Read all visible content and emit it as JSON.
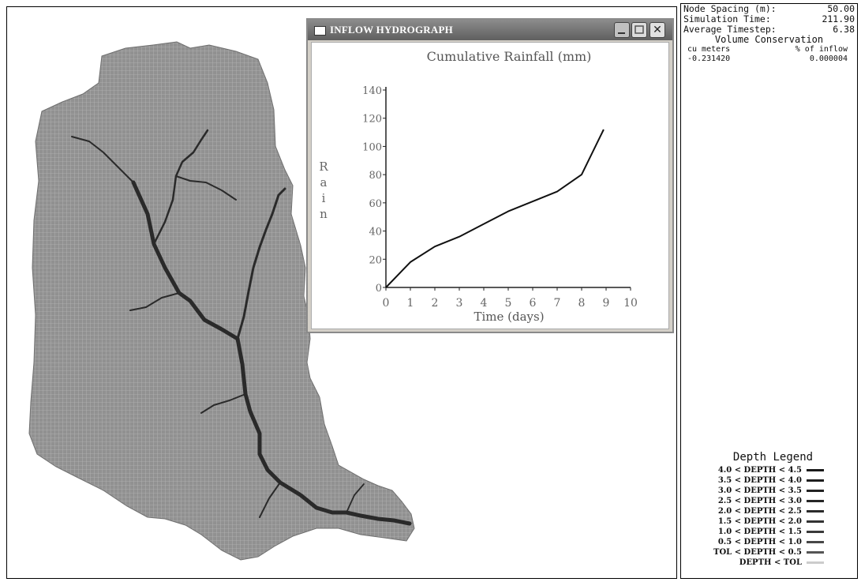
{
  "stats": {
    "node_spacing_label": "Node Spacing (m):",
    "node_spacing_value": "50.00",
    "simulation_time_label": "Simulation Time:",
    "simulation_time_value": "211.90",
    "average_timestep_label": "Average Timestep:",
    "average_timestep_value": "6.38"
  },
  "volume_conservation": {
    "title": "Volume Conservation",
    "col1_header": "cu meters",
    "col2_header": "% of inflow",
    "cu_meters": "-0.231420",
    "percent_inflow": "0.000004"
  },
  "legend": {
    "title": "Depth Legend",
    "items": [
      {
        "label": "4.0 < DEPTH < 4.5",
        "color": "#1a1a1a"
      },
      {
        "label": "3.5 < DEPTH < 4.0",
        "color": "#1e1e1e"
      },
      {
        "label": "3.0 < DEPTH < 3.5",
        "color": "#222222"
      },
      {
        "label": "2.5 < DEPTH < 3.0",
        "color": "#262626"
      },
      {
        "label": "2.0 < DEPTH < 2.5",
        "color": "#2b2b2b"
      },
      {
        "label": "1.5 < DEPTH < 2.0",
        "color": "#333333"
      },
      {
        "label": "1.0 < DEPTH < 1.5",
        "color": "#3a3a3a"
      },
      {
        "label": "0.5 < DEPTH < 1.0",
        "color": "#474747"
      },
      {
        "label": "TOL < DEPTH < 0.5",
        "color": "#555555"
      },
      {
        "label": "DEPTH < TOL",
        "color": "#cccccc"
      }
    ]
  },
  "window": {
    "title": "INFLOW HYDROGRAPH",
    "minimize_icon": "minimize-icon",
    "maximize_icon": "maximize-icon",
    "close_icon": "close-icon",
    "close_glyph": "✕"
  },
  "colors": {
    "watershed_fill": "#8f8f8f",
    "channel": "#2a2a2a"
  },
  "chart_data": {
    "type": "line",
    "title": "Cumulative Rainfall (mm)",
    "xlabel": "Time (days)",
    "ylabel": "Rain",
    "xlim": [
      0,
      10
    ],
    "ylim": [
      0,
      140
    ],
    "xticks": [
      0,
      1,
      2,
      3,
      4,
      5,
      6,
      7,
      8,
      9,
      10
    ],
    "yticks": [
      0,
      20,
      40,
      60,
      80,
      100,
      120,
      140
    ],
    "grid": false,
    "x": [
      0,
      1,
      2,
      3,
      4,
      5,
      6,
      7,
      8,
      8.9
    ],
    "y": [
      0,
      18,
      29,
      36,
      45,
      54,
      61,
      68,
      80,
      112
    ]
  }
}
